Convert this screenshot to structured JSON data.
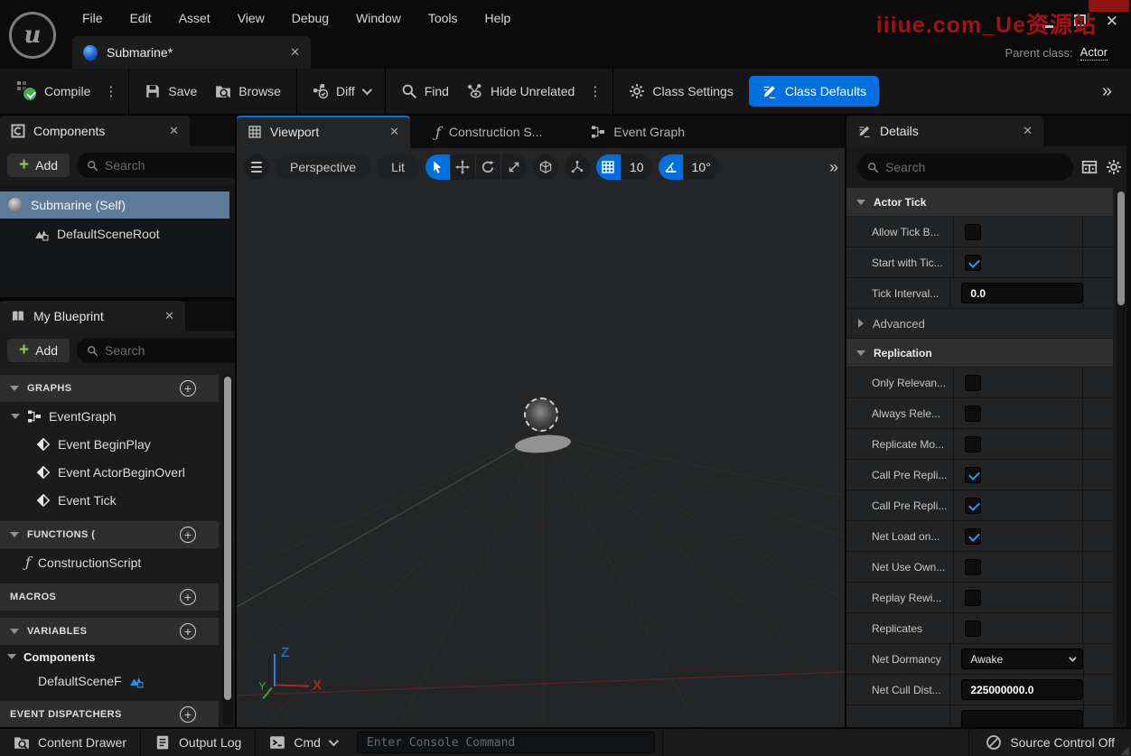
{
  "menu": {
    "items": [
      "File",
      "Edit",
      "Asset",
      "View",
      "Debug",
      "Window",
      "Tools",
      "Help"
    ]
  },
  "watermark": "iiiue.com_Ue资源站",
  "window_controls": {
    "close": "✕"
  },
  "asset_tab": {
    "title": "Submarine*",
    "close": "✕"
  },
  "parent_class": {
    "label": "Parent class:",
    "value": "Actor"
  },
  "toolbar": {
    "compile": "Compile",
    "save": "Save",
    "browse": "Browse",
    "diff": "Diff",
    "find": "Find",
    "hide_unrelated": "Hide Unrelated",
    "class_settings": "Class Settings",
    "class_defaults": "Class Defaults",
    "overflow": "»",
    "dots": "⋮"
  },
  "components_panel": {
    "title": "Components",
    "close": "✕",
    "add_label": "Add",
    "search_placeholder": "Search",
    "items": [
      {
        "label": "Submarine (Self)"
      },
      {
        "label": "DefaultSceneRoot"
      }
    ]
  },
  "my_blueprint_panel": {
    "title": "My Blueprint",
    "close": "✕",
    "add_label": "Add",
    "search_placeholder": "Search",
    "graphs_header": "GRAPHS",
    "eventgraph_label": "EventGraph",
    "events": [
      "Event BeginPlay",
      "Event ActorBeginOverl",
      "Event Tick"
    ],
    "functions_header": "FUNCTIONS (",
    "construction_script": "ConstructionScript",
    "macros_header": "MACROS",
    "variables_header": "VARIABLES",
    "components_header": "Components",
    "default_scene_root": "DefaultSceneF",
    "event_dispatchers_header": "EVENT DISPATCHERS"
  },
  "graph_tabs": {
    "viewport": "Viewport",
    "viewport_close": "✕",
    "construction": "Construction S...",
    "event_graph": "Event Graph"
  },
  "viewport_toolbar": {
    "perspective": "Perspective",
    "lit": "Lit",
    "grid_snap_value": "10",
    "rotation_snap_value": "10°",
    "overflow": "»"
  },
  "viewport": {
    "axis_x": "X",
    "axis_y": "Y",
    "axis_z": "Z"
  },
  "details_panel": {
    "title": "Details",
    "close": "✕",
    "search_placeholder": "Search",
    "rows": [
      {
        "type": "section",
        "label": "Actor Tick"
      },
      {
        "type": "checkbox",
        "label": "Allow Tick B...",
        "checked": false
      },
      {
        "type": "checkbox",
        "label": "Start with Tic...",
        "checked": true
      },
      {
        "type": "text",
        "label": "Tick Interval...",
        "value": "0.0"
      },
      {
        "type": "advanced",
        "label": "Advanced"
      },
      {
        "type": "section",
        "label": "Replication"
      },
      {
        "type": "checkbox",
        "label": "Only Relevan...",
        "checked": false
      },
      {
        "type": "checkbox",
        "label": "Always Rele...",
        "checked": false
      },
      {
        "type": "checkbox",
        "label": "Replicate Mo...",
        "checked": false
      },
      {
        "type": "checkbox",
        "label": "Call Pre Repli...",
        "checked": true
      },
      {
        "type": "checkbox",
        "label": "Call Pre Repli...",
        "checked": true
      },
      {
        "type": "checkbox",
        "label": "Net Load on...",
        "checked": true
      },
      {
        "type": "checkbox",
        "label": "Net Use Own...",
        "checked": false
      },
      {
        "type": "checkbox",
        "label": "Replay Rewi...",
        "checked": false
      },
      {
        "type": "checkbox",
        "label": "Replicates",
        "checked": false
      },
      {
        "type": "dropdown",
        "label": "Net Dormancy",
        "value": "Awake"
      },
      {
        "type": "text",
        "label": "Net Cull Dist...",
        "value": "225000000.0"
      }
    ]
  },
  "status_bar": {
    "content_drawer": "Content Drawer",
    "output_log": "Output Log",
    "cmd": "Cmd",
    "console_placeholder": "Enter Console Command",
    "source_control": "Source Control Off"
  },
  "colors": {
    "accent_blue": "#0070e0",
    "compile_green": "#3fae4a",
    "add_green": "#95c94c",
    "selected_row_blue": "#5d7a99",
    "watermark_red": "#a31212"
  }
}
